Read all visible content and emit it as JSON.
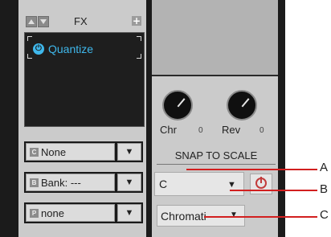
{
  "fx": {
    "title": "FX",
    "add_icon": "plus-icon",
    "effect": {
      "name": "Quantize",
      "power_icon": "power-icon",
      "color": "#3fb8ec"
    }
  },
  "selectors": [
    {
      "tag": "C",
      "value": "None",
      "arrow": "▼"
    },
    {
      "tag": "B",
      "value": "Bank: ---",
      "arrow": "▼"
    },
    {
      "tag": "P",
      "value": "none",
      "arrow": "▼"
    }
  ],
  "knobs": [
    {
      "label": "Chr",
      "value": "0"
    },
    {
      "label": "Rev",
      "value": "0"
    }
  ],
  "snap": {
    "title": "SNAP TO SCALE",
    "key": "C",
    "key_arrow": "▼",
    "power_icon": "power-icon",
    "power_color": "#c23b3b",
    "scale": "Chromati",
    "scale_arrow": "▼"
  },
  "callouts": {
    "a": "A",
    "b": "B",
    "c": "C",
    "color": "#d21f1f"
  }
}
